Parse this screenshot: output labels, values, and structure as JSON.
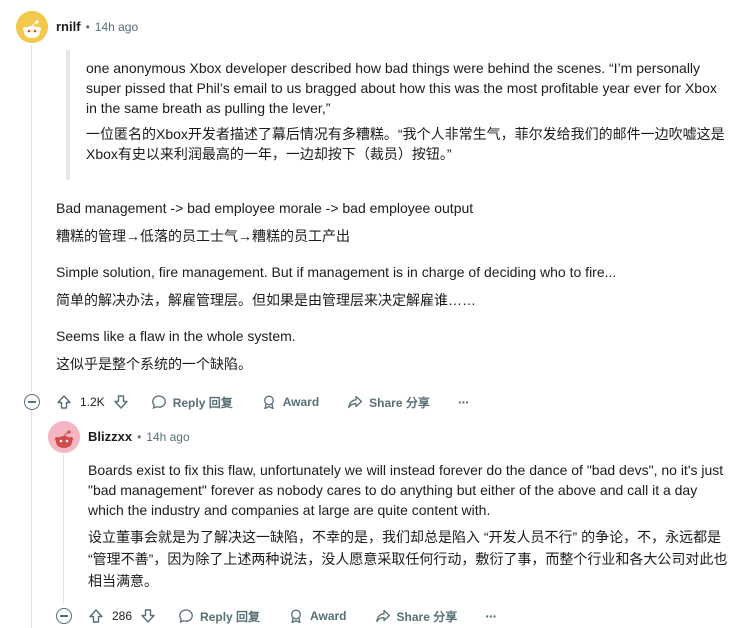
{
  "comment1": {
    "author": "rnilf",
    "separator": "•",
    "time": "14h ago",
    "quote_en": "one anonymous Xbox developer described how bad things were behind the scenes. “I’m personally super pissed that Phil’s email to us bragged about how this was the most profitable year ever for Xbox in the same breath as pulling the lever,”",
    "quote_zh": "一位匿名的Xbox开发者描述了幕后情况有多糟糕。“我个人非常生气，菲尔发给我们的邮件一边吹嘘这是Xbox有史以来利润最高的一年，一边却按下（裁员）按钮。”",
    "p1_en": "Bad management -> bad employee morale -> bad employee output",
    "p1_zh": "糟糕的管理→低落的员工士气→糟糕的员工产出",
    "p2_en": "Simple solution, fire management. But if management is in charge of deciding who to fire...",
    "p2_zh": "简单的解决办法，解雇管理层。但如果是由管理层来决定解雇谁……",
    "p3_en": "Seems like a flaw in the whole system.",
    "p3_zh": "这似乎是整个系统的一个缺陷。",
    "votes": "1.2K",
    "reply": "Reply 回复",
    "award": "Award",
    "share": "Share 分享",
    "more": "···"
  },
  "comment2": {
    "author": "Blizzxx",
    "separator": "•",
    "time": "14h ago",
    "p_en": "Boards exist to fix this flaw, unfortunately we will instead forever do the dance of \"bad devs\", no it's just \"bad management\" forever as nobody cares to do anything but  either of the above and call it a day which the industry and companies at large are quite content with.",
    "p_zh": "设立董事会就是为了解决这一缺陷，不幸的是，我们却总是陷入 “开发人员不行” 的争论，不，永远都是 “管理不善”，因为除了上述两种说法，没人愿意采取任何行动，敷衍了事，而整个行业和各大公司对此也相当满意。",
    "votes": "286",
    "reply": "Reply 回复",
    "award": "Award",
    "share": "Share 分享",
    "more": "···"
  },
  "colors": {
    "avatar1_bg": "#f2c94c",
    "avatar2_bg": "#f4b6c2",
    "muted": "#576f76"
  }
}
